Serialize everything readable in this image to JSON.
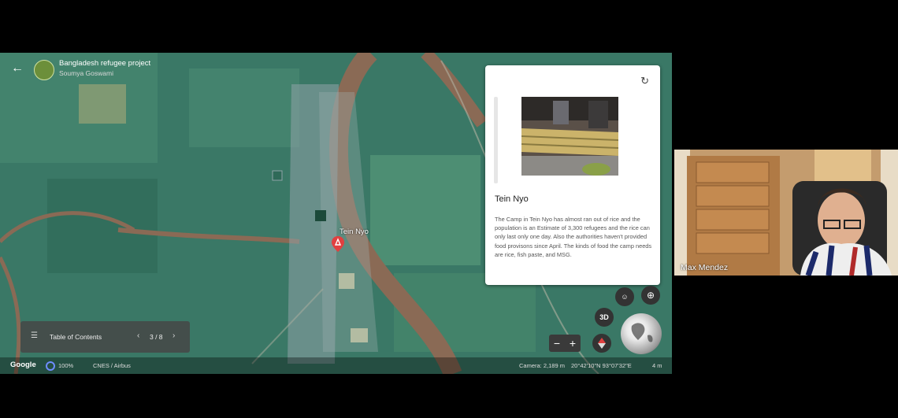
{
  "project": {
    "title": "Bangladesh refugee project",
    "author": "Soumya Goswami"
  },
  "placemark": {
    "label": "Tein Nyo"
  },
  "card": {
    "place_title": "Tein Nyo",
    "description": "The Camp in Tein Nyo has almost ran out of rice and the population is an Estimate of 3,300 refugees and the rice can only last only one day. Also the authorities haven't provided food provisons since April. The kinds of food the camp needs are rice, fish paste, and MSG."
  },
  "toc": {
    "label": "Table of Contents",
    "page": "3 / 8"
  },
  "controls": {
    "mode_3d": "3D",
    "zoom_out": "−",
    "zoom_in": "+"
  },
  "status": {
    "logo": "Google",
    "percent": "100%",
    "credits": "CNES / Airbus",
    "camera": "Camera: 2,189 m",
    "coords": "20°42'10\"N 93°07'32\"E",
    "scale": "4 m"
  },
  "participant": {
    "name": "Max Mendez"
  },
  "icons": {
    "back": "arrow-left-icon",
    "refresh": "refresh-icon",
    "list": "list-icon",
    "prev": "chevron-left-icon",
    "next": "chevron-right-icon",
    "pegman": "pegman-icon",
    "locate": "target-icon",
    "compass": "compass-icon"
  },
  "colors": {
    "river": "#8a6a55",
    "land": "#3c7a66",
    "placemark": "#e04040",
    "card_bg": "#ffffff"
  }
}
